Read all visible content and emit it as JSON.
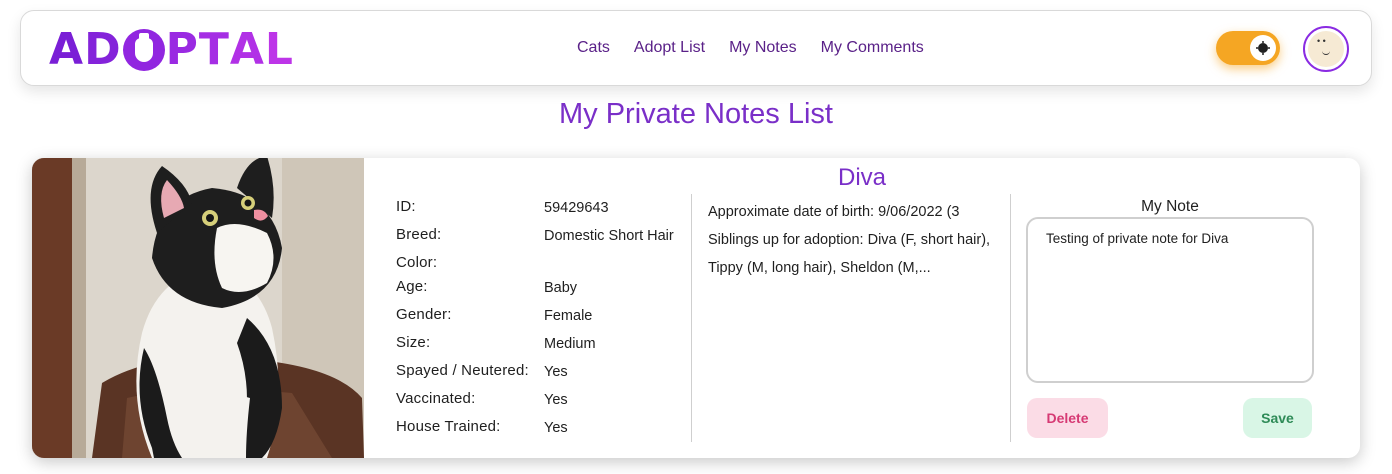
{
  "brand": {
    "logo_text": "ADOPTAL"
  },
  "nav": {
    "links": [
      "Cats",
      "Adopt List",
      "My Notes",
      "My Comments"
    ]
  },
  "controls": {
    "theme_toggle_state": "light",
    "accent_color": "#f5a623",
    "avatar_icon": "avatar-face-icon"
  },
  "page": {
    "title": "My Private Notes List"
  },
  "card": {
    "name": "Diva",
    "details": [
      {
        "label": "ID:",
        "value": "59429643"
      },
      {
        "label": "Breed:",
        "value": "Domestic Short Hair"
      },
      {
        "label": "Color:",
        "value": ""
      },
      {
        "label": "Age:",
        "value": "Baby"
      },
      {
        "label": "Gender:",
        "value": "Female"
      },
      {
        "label": "Size:",
        "value": "Medium"
      },
      {
        "label": "Spayed / Neutered:",
        "value": "Yes"
      },
      {
        "label": "Vaccinated:",
        "value": "Yes"
      },
      {
        "label": "House Trained:",
        "value": "Yes"
      }
    ],
    "description_lines": [
      "Approximate date of birth: 9/06/2022 (3",
      "Siblings up for adoption: Diva (F, short hair),",
      "Tippy (M, long hair), Sheldon (M,..."
    ],
    "note": {
      "title": "My Note",
      "text": "Testing of private note for Diva"
    },
    "buttons": {
      "delete": "Delete",
      "save": "Save"
    }
  },
  "colors": {
    "brand_purple": "#7a2fc8",
    "delete_bg": "#fbdce6",
    "delete_text": "#d63a74",
    "save_bg": "#d9f6e6",
    "save_text": "#2e8b57"
  }
}
